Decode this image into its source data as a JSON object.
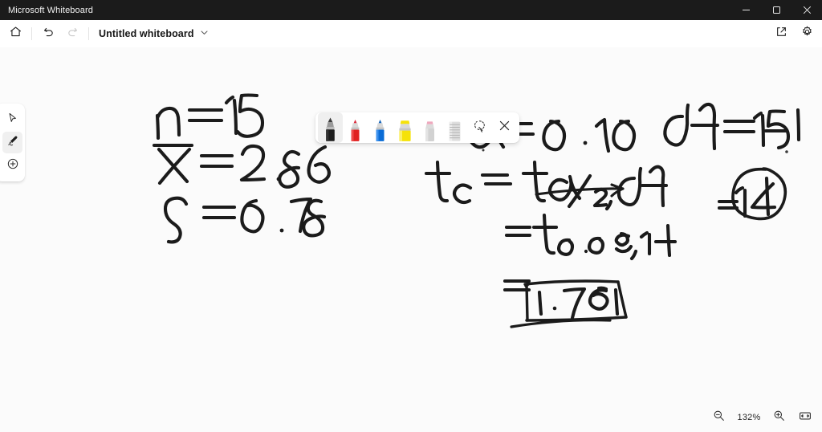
{
  "window": {
    "app_title": "Microsoft Whiteboard",
    "minimize_label": "Minimize",
    "maximize_label": "Maximize",
    "close_label": "Close"
  },
  "commandbar": {
    "home_label": "Home",
    "undo_label": "Undo",
    "redo_label": "Redo",
    "document_title": "Untitled whiteboard",
    "dropdown_label": "More options",
    "share_label": "Share",
    "settings_label": "Settings"
  },
  "toolrail": {
    "items": [
      {
        "name": "select",
        "label": "Select"
      },
      {
        "name": "pen",
        "label": "Ink",
        "selected": true
      },
      {
        "name": "add",
        "label": "Create"
      }
    ]
  },
  "pentoolbar": {
    "tools": [
      {
        "name": "black-pen",
        "label": "Pen — black",
        "color": "#1a1a1a",
        "selected": true
      },
      {
        "name": "red-pen",
        "label": "Pen — red",
        "color": "#e02020",
        "selected": false
      },
      {
        "name": "blue-pen",
        "label": "Pen — blue",
        "color": "#0a6cd6",
        "selected": false
      },
      {
        "name": "yellow-highlighter",
        "label": "Highlighter — yellow",
        "color": "#f5e209",
        "selected": false
      },
      {
        "name": "eraser",
        "label": "Eraser",
        "color": "#efa8bd",
        "selected": false
      },
      {
        "name": "ruler",
        "label": "Ruler",
        "color": "#d8d8d8",
        "selected": false
      }
    ],
    "lasso_label": "Lasso select",
    "close_label": "Close ink toolbar"
  },
  "canvas": {
    "background_color": "#fbfbfb",
    "ink_color": "#1b1b1b",
    "notes": [
      {
        "name": "sample-size",
        "text": "n = 15"
      },
      {
        "name": "sample-mean",
        "text": "x̄ = 2.86"
      },
      {
        "name": "sample-stdev",
        "text": "s = 0.78"
      },
      {
        "name": "alpha",
        "text": "α = 0.10"
      },
      {
        "name": "degrees-of-freedom",
        "text": "df = 15 − 1"
      },
      {
        "name": "df-result-circled",
        "text": "= 14"
      },
      {
        "name": "t-critical-formula",
        "text": "tₑ = tα/2, df"
      },
      {
        "name": "t-critical-substituted",
        "text": "= t0.05, 14"
      },
      {
        "name": "t-critical-value-boxed",
        "text": "= 1.761"
      }
    ]
  },
  "zoomcontrols": {
    "zoom_out_label": "Zoom out",
    "zoom_level": "132%",
    "zoom_in_label": "Zoom in",
    "fit_label": "Fit to screen"
  }
}
